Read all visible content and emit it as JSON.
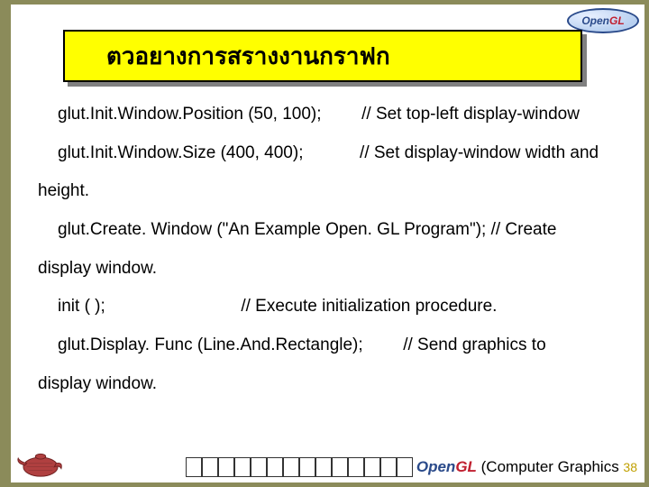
{
  "logo": {
    "part1": "Open",
    "part2": "GL"
  },
  "title": "ตวอยางการสรางงานกราฟก",
  "code": {
    "l1a": "glut.Init.Window.Position (50, 100);",
    "l1b": "// Set top-left display-window",
    "l2a": "glut.Init.Window.Size (400, 400);",
    "l2b": "// Set display-window width and",
    "l3": "height.",
    "l4": "glut.Create. Window (\"An Example Open. GL Program\"); // Create",
    "l5": "display window.",
    "l6a": "init ( );",
    "l6b": " // Execute initialization procedure.",
    "l7a": "glut.Display. Func (Line.And.Rectangle);",
    "l7b": " // Send graphics to",
    "l8": "display window."
  },
  "footer": {
    "brand1": "Open",
    "brand2": "GL",
    "text": " (Computer Graphics ",
    "page": "38"
  }
}
